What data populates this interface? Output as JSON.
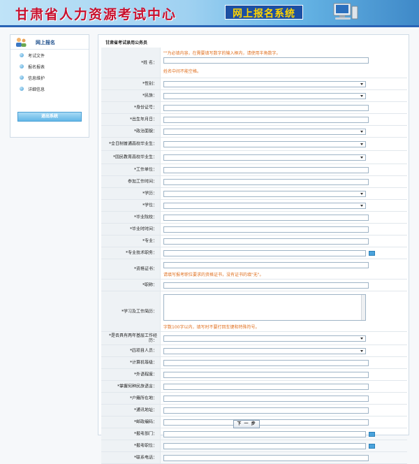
{
  "banner": {
    "title": "甘肃省人力资源考试中心",
    "subtitle": "网上报名系统"
  },
  "sidebar": {
    "title": "网上报名",
    "items": [
      {
        "label": "考试文件"
      },
      {
        "label": "报名报表"
      },
      {
        "label": "信息维护"
      },
      {
        "label": "详细信息"
      }
    ],
    "logout": "退出系统"
  },
  "main": {
    "title": "甘肃省考试录用公务员",
    "fields": {
      "name": {
        "label": "*姓 名：",
        "hint_top": "\"\"为必填内容，在需要填写数字的输入框内，请使用半角数字。",
        "hint_bottom": "姓名中间不能空格。"
      },
      "gender": {
        "label": "*性别："
      },
      "ethnicity": {
        "label": "*民族："
      },
      "id_card": {
        "label": "*身份证号："
      },
      "birth": {
        "label": "*出生年月日："
      },
      "political": {
        "label": "*政治面貌："
      },
      "fulltime_grad": {
        "label": "*全日制普通高校毕业生："
      },
      "national_edu_grad": {
        "label": "*国民教育高校毕业生："
      },
      "work_unit": {
        "label": "*工作单位："
      },
      "work_start": {
        "label": "参加工作时间："
      },
      "education": {
        "label": "*学历："
      },
      "degree": {
        "label": "*学位："
      },
      "school": {
        "label": "*毕业院校："
      },
      "grad_time": {
        "label": "*毕业时时间："
      },
      "major": {
        "label": "*专业："
      },
      "title_rank": {
        "label": "*专业技术职务："
      },
      "certificate": {
        "label": "*资格证书：",
        "hint": "请填写报考职位要求的资格证书，没有证书的填\"无\"。"
      },
      "position": {
        "label": "*职称："
      },
      "resume": {
        "label": "*学习及工作简历：",
        "hint": "字数100字以内，填写时不要打回车键和特殊符号。"
      },
      "grassroots": {
        "label": "*是否具有两年基层工作经历："
      },
      "four_types": {
        "label": "*四项目人员："
      },
      "computer_level": {
        "label": "*计算机等级："
      },
      "foreign_level": {
        "label": "*外语程度："
      },
      "language": {
        "label": "*掌握何种民族语言："
      },
      "hukou": {
        "label": "*户籍所在地："
      },
      "address": {
        "label": "*通讯地址："
      },
      "postcode": {
        "label": "*邮政编码："
      },
      "dept": {
        "label": "*报考部门："
      },
      "job": {
        "label": "*报考职位："
      },
      "phone": {
        "label": "*联系电话："
      }
    },
    "next_button": "下 一 步"
  },
  "colors": {
    "accent": "#2a64b5",
    "hint": "#e07020",
    "banner_title": "#c8102e",
    "banner_sub_text": "#ffd400"
  }
}
